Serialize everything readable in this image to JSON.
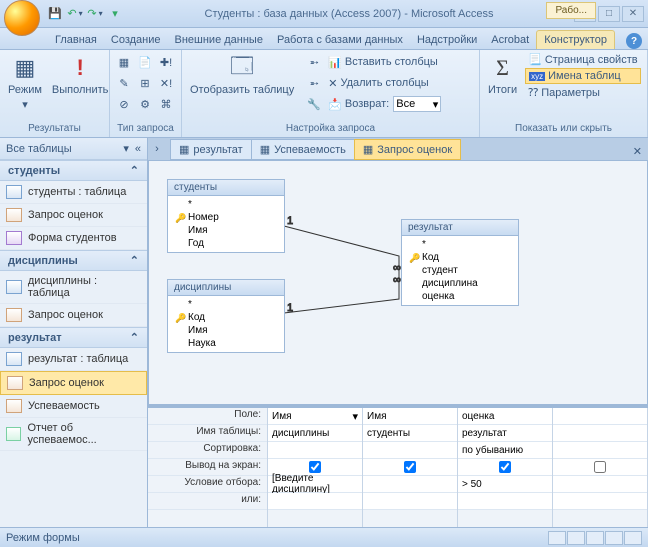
{
  "title": "Студенты : база данных (Access 2007) - Microsoft Access",
  "context_tab": "Рабо...",
  "tabs": [
    "Главная",
    "Создание",
    "Внешние данные",
    "Работа с базами данных",
    "Надстройки",
    "Acrobat",
    "Конструктор"
  ],
  "active_tab": 6,
  "ribbon": {
    "g1": {
      "label": "Результаты",
      "mode": "Режим",
      "run": "Выполнить"
    },
    "g2": {
      "label": "Тип запроса"
    },
    "g3": {
      "label": "Настройка запроса",
      "show_table": "Отобразить таблицу",
      "insert_cols": "Вставить столбцы",
      "delete_cols": "Удалить столбцы",
      "return": "Возврат:",
      "return_val": "Все"
    },
    "g4": {
      "label": "Показать или скрыть",
      "totals": "Итоги",
      "prop_page": "Страница свойств",
      "table_names": "Имена таблиц",
      "params": "Параметры"
    }
  },
  "nav": {
    "header": "Все таблицы",
    "groups": [
      {
        "title": "студенты",
        "items": [
          {
            "icon": "tbl",
            "label": "студенты : таблица"
          },
          {
            "icon": "qry",
            "label": "Запрос оценок"
          },
          {
            "icon": "frm",
            "label": "Форма студентов"
          }
        ]
      },
      {
        "title": "дисциплины",
        "items": [
          {
            "icon": "tbl",
            "label": "дисциплины : таблица"
          },
          {
            "icon": "qry",
            "label": "Запрос оценок"
          }
        ]
      },
      {
        "title": "результат",
        "items": [
          {
            "icon": "tbl",
            "label": "результат : таблица"
          },
          {
            "icon": "qry",
            "label": "Запрос оценок",
            "sel": true
          },
          {
            "icon": "qry",
            "label": "Успеваемость"
          },
          {
            "icon": "rpt",
            "label": "Отчет об успеваемос..."
          }
        ]
      }
    ]
  },
  "doc_tabs": [
    {
      "label": "результат"
    },
    {
      "label": "Успеваемость"
    },
    {
      "label": "Запрос оценок",
      "active": true
    }
  ],
  "tables": {
    "students": {
      "title": "студенты",
      "fields": [
        "*",
        "Номер",
        "Имя",
        "Год"
      ],
      "key": 1
    },
    "disciplines": {
      "title": "дисциплины",
      "fields": [
        "*",
        "Код",
        "Имя",
        "Наука"
      ],
      "key": 1
    },
    "result": {
      "title": "результат",
      "fields": [
        "*",
        "Код",
        "студент",
        "дисциплина",
        "оценка"
      ],
      "key": 1
    }
  },
  "grid": {
    "rows": [
      "Поле:",
      "Имя таблицы:",
      "Сортировка:",
      "Вывод на экран:",
      "Условие отбора:",
      "или:"
    ],
    "cols": [
      {
        "field": "Имя",
        "table": "дисциплины",
        "sort": "",
        "show": true,
        "crit": "[Введите дисциплину]",
        "or": ""
      },
      {
        "field": "Имя",
        "table": "студенты",
        "sort": "",
        "show": true,
        "crit": "",
        "or": ""
      },
      {
        "field": "оценка",
        "table": "результат",
        "sort": "по убыванию",
        "show": true,
        "crit": "> 50",
        "or": ""
      },
      {
        "field": "",
        "table": "",
        "sort": "",
        "show": false,
        "crit": "",
        "or": ""
      }
    ]
  },
  "status": "Режим формы"
}
